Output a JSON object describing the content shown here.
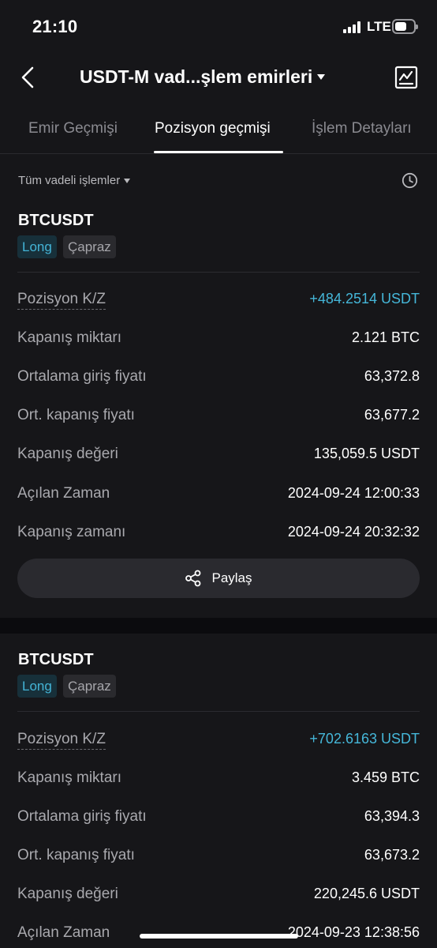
{
  "status_bar": {
    "time": "21:10",
    "network": "LTE",
    "battery_level": 0.65
  },
  "header": {
    "title": "USDT-M vad...şlem emirleri"
  },
  "tabs": [
    {
      "label": "Emir Geçmişi",
      "active": false
    },
    {
      "label": "Pozisyon geçmişi",
      "active": true
    },
    {
      "label": "İşlem Detayları",
      "active": false
    }
  ],
  "filter": {
    "label": "Tüm vadeli işlemler"
  },
  "positions": [
    {
      "symbol": "BTCUSDT",
      "side": "Long",
      "margin_mode": "Çapraz",
      "rows": [
        {
          "label": "Pozisyon K/Z",
          "value": "+484.2514 USDT"
        },
        {
          "label": "Kapanış miktarı",
          "value": "2.121 BTC"
        },
        {
          "label": "Ortalama giriş fiyatı",
          "value": "63,372.8"
        },
        {
          "label": "Ort. kapanış fiyatı",
          "value": "63,677.2"
        },
        {
          "label": "Kapanış değeri",
          "value": "135,059.5 USDT"
        },
        {
          "label": "Açılan Zaman",
          "value": "2024-09-24 12:00:33"
        },
        {
          "label": "Kapanış zamanı",
          "value": "2024-09-24 20:32:32"
        }
      ],
      "share_label": "Paylaş"
    },
    {
      "symbol": "BTCUSDT",
      "side": "Long",
      "margin_mode": "Çapraz",
      "rows": [
        {
          "label": "Pozisyon K/Z",
          "value": "+702.6163 USDT"
        },
        {
          "label": "Kapanış miktarı",
          "value": "3.459 BTC"
        },
        {
          "label": "Ortalama giriş fiyatı",
          "value": "63,394.3"
        },
        {
          "label": "Ort. kapanış fiyatı",
          "value": "63,673.2"
        },
        {
          "label": "Kapanış değeri",
          "value": "220,245.6 USDT"
        },
        {
          "label": "Açılan Zaman",
          "value": "2024-09-23 12:38:56"
        }
      ]
    }
  ],
  "colors": {
    "background": "#161619",
    "accent_positive": "#45b7d9",
    "long_badge_bg": "#17303a",
    "long_badge_text": "#44b4d6"
  }
}
